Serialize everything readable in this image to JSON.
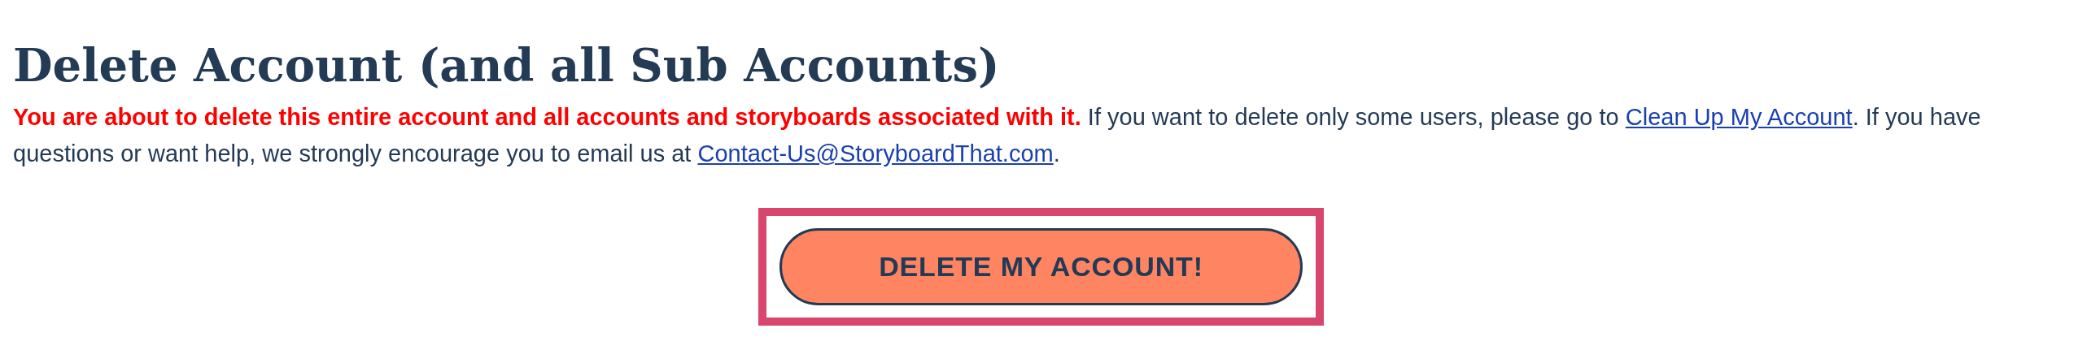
{
  "title": "Delete Account (and all Sub Accounts)",
  "notice": [
    {
      "kind": "warning",
      "text": "You are about to delete this entire account and all accounts and storyboards associated with it."
    },
    {
      "kind": "text",
      "text": " If you want to delete only some users, please go to "
    },
    {
      "kind": "link",
      "text": "Clean Up My Account"
    },
    {
      "kind": "text",
      "text": ". If you have questions or want help, we strongly encourage you to email us at "
    },
    {
      "kind": "link",
      "text": "Contact-Us@StoryboardThat.com"
    },
    {
      "kind": "text",
      "text": "."
    }
  ],
  "delete_button": {
    "label": "DELETE MY ACCOUNT!",
    "highlighted": true
  }
}
